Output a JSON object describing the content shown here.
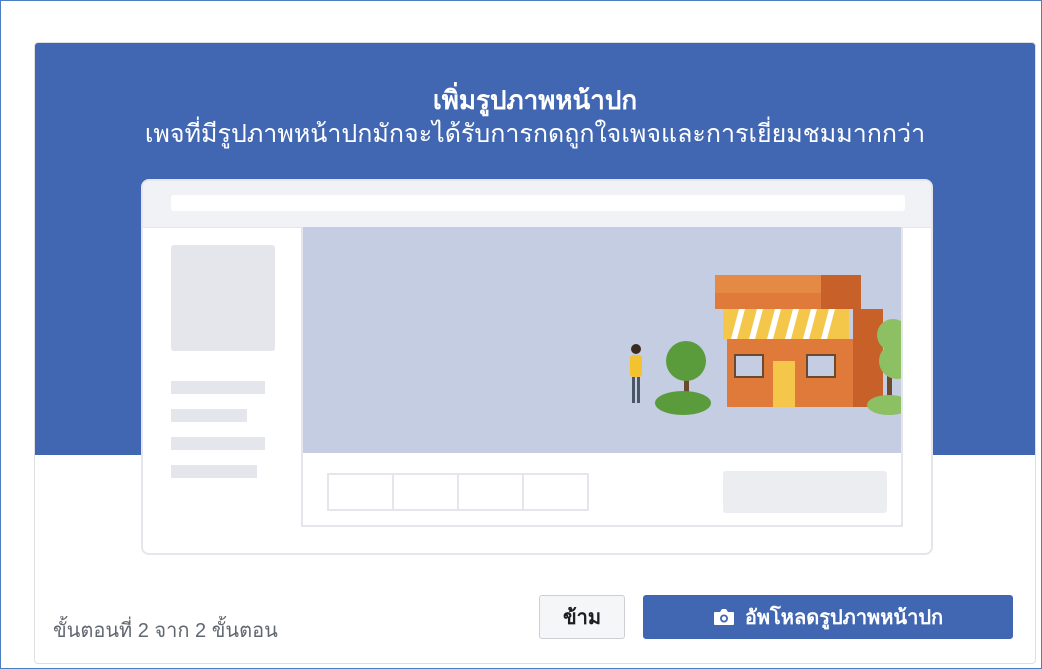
{
  "banner": {
    "title": "เพิ่มรูปภาพหน้าปก",
    "subtitle": "เพจที่มีรูปภาพหน้าปกมักจะได้รับการกดถูกใจเพจและการเยี่ยมชมมากกว่า",
    "background_color": "#4267b2"
  },
  "footer": {
    "step_text": "ขั้นตอนที่ 2 จาก 2 ขั้นตอน",
    "skip_label": "ข้าม",
    "upload_label": "อัพโหลดรูปภาพหน้าปก",
    "upload_icon": "camera-icon"
  },
  "colors": {
    "primary_blue": "#4267b2",
    "placeholder_gray": "#e4e6eb",
    "cover_area": "#c5cde2"
  }
}
